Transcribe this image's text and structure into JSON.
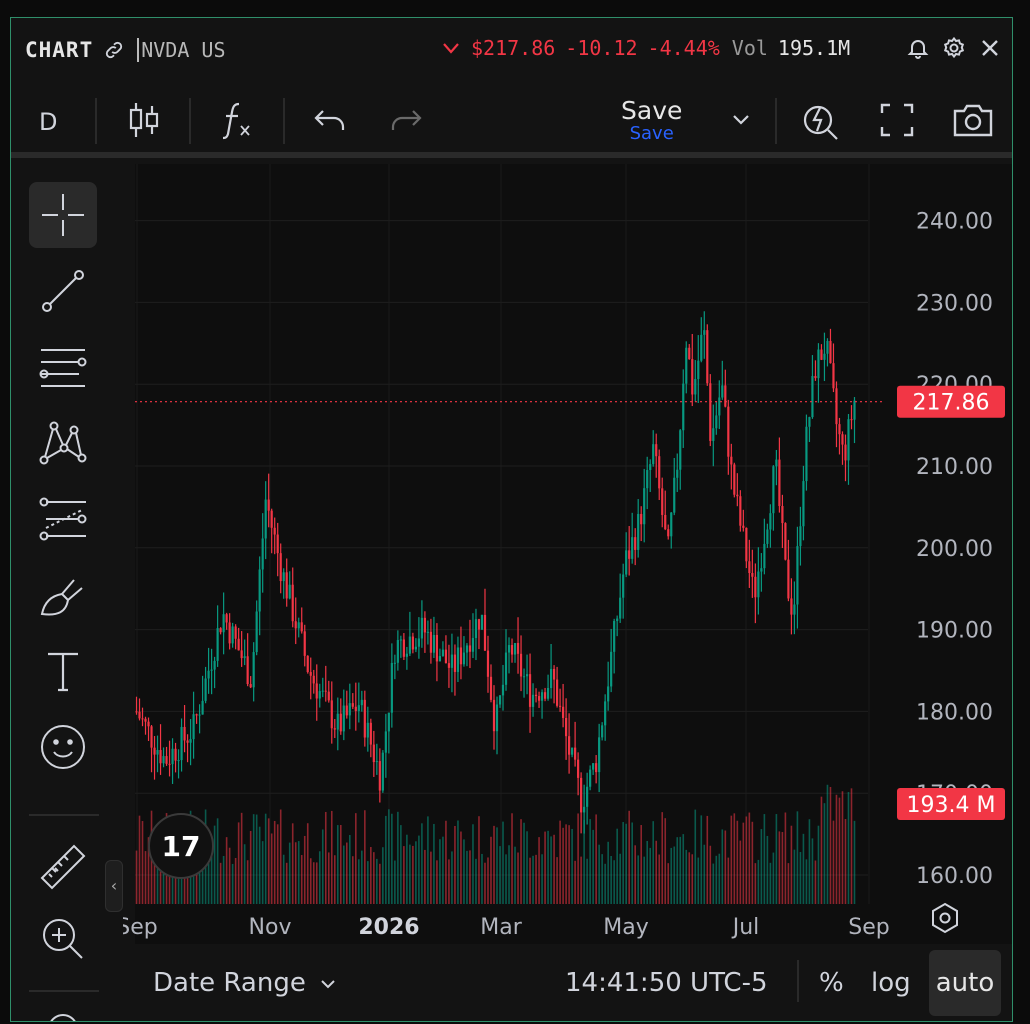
{
  "topbar": {
    "brand": "CHART",
    "symbol": "NVDA US",
    "price": "$217.86",
    "change": "-10.12",
    "change_pct": "-4.44%",
    "vol_label": "Vol",
    "vol_value": "195.1M"
  },
  "toolbar": {
    "interval": "D",
    "save_label": "Save",
    "save_sub": "Save"
  },
  "bottombar": {
    "date_range": "Date Range",
    "time": "14:41:50 UTC-5",
    "percent": "%",
    "log": "log",
    "auto": "auto"
  },
  "colors": {
    "up": "#089981",
    "down": "#f23645",
    "accent": "#2962ff",
    "frame": "#2f8f6a"
  },
  "chart_data": {
    "type": "candlestick",
    "symbol": "NVDA US",
    "y_ticks": [
      "240.00",
      "230.00",
      "220.00",
      "210.00",
      "200.00",
      "190.00",
      "180.00",
      "170.00",
      "160.00"
    ],
    "x_ticks": [
      "Sep",
      "Nov",
      "2026",
      "Mar",
      "May",
      "Jul",
      "Sep"
    ],
    "ylim": [
      158,
      244
    ],
    "last_price_label": "217.86",
    "last_price": 217.86,
    "volume_label": "193.4 M",
    "segments": [
      {
        "x": 0.0,
        "v": 180
      },
      {
        "x": 0.04,
        "v": 174
      },
      {
        "x": 0.08,
        "v": 178
      },
      {
        "x": 0.12,
        "v": 192
      },
      {
        "x": 0.16,
        "v": 184
      },
      {
        "x": 0.18,
        "v": 206
      },
      {
        "x": 0.2,
        "v": 198
      },
      {
        "x": 0.24,
        "v": 185
      },
      {
        "x": 0.28,
        "v": 178
      },
      {
        "x": 0.31,
        "v": 181
      },
      {
        "x": 0.34,
        "v": 172
      },
      {
        "x": 0.36,
        "v": 188
      },
      {
        "x": 0.4,
        "v": 190
      },
      {
        "x": 0.44,
        "v": 185
      },
      {
        "x": 0.48,
        "v": 192
      },
      {
        "x": 0.5,
        "v": 178
      },
      {
        "x": 0.52,
        "v": 188
      },
      {
        "x": 0.55,
        "v": 182
      },
      {
        "x": 0.58,
        "v": 184
      },
      {
        "x": 0.6,
        "v": 176
      },
      {
        "x": 0.62,
        "v": 169
      },
      {
        "x": 0.64,
        "v": 174
      },
      {
        "x": 0.66,
        "v": 186
      },
      {
        "x": 0.68,
        "v": 198
      },
      {
        "x": 0.7,
        "v": 203
      },
      {
        "x": 0.72,
        "v": 212
      },
      {
        "x": 0.74,
        "v": 199
      },
      {
        "x": 0.755,
        "v": 212
      },
      {
        "x": 0.765,
        "v": 226
      },
      {
        "x": 0.775,
        "v": 219
      },
      {
        "x": 0.79,
        "v": 227
      },
      {
        "x": 0.8,
        "v": 213
      },
      {
        "x": 0.815,
        "v": 220
      },
      {
        "x": 0.83,
        "v": 208
      },
      {
        "x": 0.845,
        "v": 201
      },
      {
        "x": 0.86,
        "v": 194
      },
      {
        "x": 0.875,
        "v": 202
      },
      {
        "x": 0.89,
        "v": 210
      },
      {
        "x": 0.905,
        "v": 196
      },
      {
        "x": 0.915,
        "v": 192
      },
      {
        "x": 0.93,
        "v": 211
      },
      {
        "x": 0.945,
        "v": 222
      },
      {
        "x": 0.96,
        "v": 225
      },
      {
        "x": 0.975,
        "v": 215
      },
      {
        "x": 0.985,
        "v": 211
      },
      {
        "x": 1.0,
        "v": 218
      }
    ]
  }
}
